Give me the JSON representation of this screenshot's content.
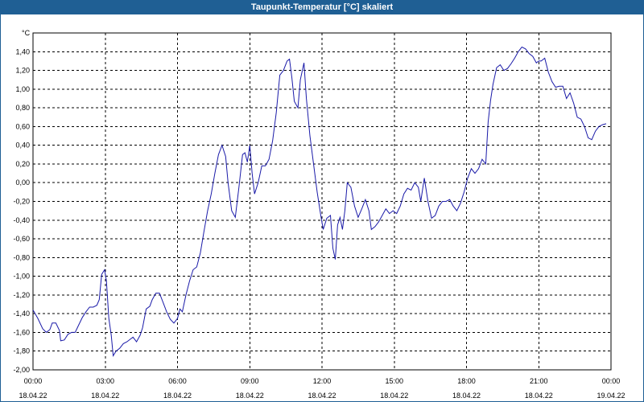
{
  "window": {
    "title": "Taupunkt-Temperatur [°C] skaliert"
  },
  "colors": {
    "titlebar": "#1f5f94",
    "series": "#1a1aa8",
    "grid": "#000000",
    "background": "#ffffff"
  },
  "chart_data": {
    "type": "line",
    "title": "Taupunkt-Temperatur [°C] skaliert",
    "ylabel": "°C",
    "xlabel": "",
    "ylim": [
      -2.0,
      1.6
    ],
    "grid": true,
    "y_ticks": [
      "1,40",
      "1,20",
      "1,00",
      "0,80",
      "0,60",
      "0,40",
      "0,20",
      "0,00",
      "-0,20",
      "-0,40",
      "-0,60",
      "-0,80",
      "-1,00",
      "-1,20",
      "-1,40",
      "-1,60",
      "-1,80",
      "-2,00"
    ],
    "x_ticks": [
      {
        "time": "00:00",
        "date": "18.04.22"
      },
      {
        "time": "03:00",
        "date": "18.04.22"
      },
      {
        "time": "06:00",
        "date": "18.04.22"
      },
      {
        "time": "09:00",
        "date": "18.04.22"
      },
      {
        "time": "12:00",
        "date": "18.04.22"
      },
      {
        "time": "15:00",
        "date": "18.04.22"
      },
      {
        "time": "18:00",
        "date": "18.04.22"
      },
      {
        "time": "21:00",
        "date": "18.04.22"
      },
      {
        "time": "00:00",
        "date": "19.04.22"
      }
    ],
    "xlim_hours": [
      0,
      24
    ],
    "series": [
      {
        "values": [
          [
            0.0,
            -1.36
          ],
          [
            0.2,
            -1.45
          ],
          [
            0.4,
            -1.56
          ],
          [
            0.55,
            -1.6
          ],
          [
            0.7,
            -1.57
          ],
          [
            0.8,
            -1.5
          ],
          [
            0.95,
            -1.5
          ],
          [
            1.1,
            -1.58
          ],
          [
            1.15,
            -1.69
          ],
          [
            1.3,
            -1.68
          ],
          [
            1.45,
            -1.62
          ],
          [
            1.6,
            -1.6
          ],
          [
            1.75,
            -1.6
          ],
          [
            1.9,
            -1.52
          ],
          [
            2.05,
            -1.44
          ],
          [
            2.2,
            -1.38
          ],
          [
            2.35,
            -1.33
          ],
          [
            2.5,
            -1.33
          ],
          [
            2.65,
            -1.31
          ],
          [
            2.75,
            -1.25
          ],
          [
            2.85,
            -0.98
          ],
          [
            2.97,
            -0.93
          ],
          [
            3.05,
            -1.05
          ],
          [
            3.15,
            -1.45
          ],
          [
            3.25,
            -1.63
          ],
          [
            3.33,
            -1.85
          ],
          [
            3.45,
            -1.8
          ],
          [
            3.6,
            -1.77
          ],
          [
            3.75,
            -1.72
          ],
          [
            3.9,
            -1.7
          ],
          [
            4.05,
            -1.67
          ],
          [
            4.15,
            -1.65
          ],
          [
            4.3,
            -1.7
          ],
          [
            4.45,
            -1.63
          ],
          [
            4.55,
            -1.55
          ],
          [
            4.7,
            -1.35
          ],
          [
            4.85,
            -1.32
          ],
          [
            4.95,
            -1.25
          ],
          [
            5.1,
            -1.18
          ],
          [
            5.25,
            -1.18
          ],
          [
            5.4,
            -1.28
          ],
          [
            5.55,
            -1.38
          ],
          [
            5.7,
            -1.46
          ],
          [
            5.85,
            -1.5
          ],
          [
            6.0,
            -1.45
          ],
          [
            6.1,
            -1.35
          ],
          [
            6.2,
            -1.38
          ],
          [
            6.35,
            -1.2
          ],
          [
            6.5,
            -1.05
          ],
          [
            6.65,
            -0.93
          ],
          [
            6.8,
            -0.9
          ],
          [
            6.95,
            -0.75
          ],
          [
            7.1,
            -0.52
          ],
          [
            7.25,
            -0.3
          ],
          [
            7.4,
            -0.12
          ],
          [
            7.55,
            0.1
          ],
          [
            7.7,
            0.3
          ],
          [
            7.85,
            0.4
          ],
          [
            8.0,
            0.28
          ],
          [
            8.1,
            0.0
          ],
          [
            8.25,
            -0.3
          ],
          [
            8.4,
            -0.37
          ],
          [
            8.55,
            -0.05
          ],
          [
            8.7,
            0.3
          ],
          [
            8.8,
            0.32
          ],
          [
            8.9,
            0.22
          ],
          [
            9.0,
            0.4
          ],
          [
            9.1,
            0.1
          ],
          [
            9.2,
            -0.12
          ],
          [
            9.35,
            0.0
          ],
          [
            9.5,
            0.18
          ],
          [
            9.65,
            0.18
          ],
          [
            9.8,
            0.25
          ],
          [
            9.95,
            0.45
          ],
          [
            10.1,
            0.75
          ],
          [
            10.25,
            1.15
          ],
          [
            10.4,
            1.2
          ],
          [
            10.55,
            1.3
          ],
          [
            10.65,
            1.32
          ],
          [
            10.75,
            1.12
          ],
          [
            10.85,
            0.87
          ],
          [
            11.0,
            0.8
          ],
          [
            11.1,
            1.1
          ],
          [
            11.25,
            1.28
          ],
          [
            11.35,
            0.9
          ],
          [
            11.5,
            0.5
          ],
          [
            11.65,
            0.2
          ],
          [
            11.8,
            -0.1
          ],
          [
            11.95,
            -0.35
          ],
          [
            12.05,
            -0.5
          ],
          [
            12.2,
            -0.38
          ],
          [
            12.35,
            -0.35
          ],
          [
            12.45,
            -0.7
          ],
          [
            12.55,
            -0.82
          ],
          [
            12.65,
            -0.45
          ],
          [
            12.75,
            -0.37
          ],
          [
            12.85,
            -0.5
          ],
          [
            12.95,
            -0.3
          ],
          [
            13.05,
            0.0
          ],
          [
            13.2,
            -0.05
          ],
          [
            13.35,
            -0.25
          ],
          [
            13.5,
            -0.37
          ],
          [
            13.65,
            -0.28
          ],
          [
            13.8,
            -0.18
          ],
          [
            13.95,
            -0.3
          ],
          [
            14.05,
            -0.5
          ],
          [
            14.2,
            -0.47
          ],
          [
            14.35,
            -0.42
          ],
          [
            14.5,
            -0.35
          ],
          [
            14.65,
            -0.28
          ],
          [
            14.8,
            -0.33
          ],
          [
            14.95,
            -0.3
          ],
          [
            15.1,
            -0.33
          ],
          [
            15.25,
            -0.25
          ],
          [
            15.4,
            -0.12
          ],
          [
            15.55,
            -0.06
          ],
          [
            15.7,
            -0.08
          ],
          [
            15.85,
            0.0
          ],
          [
            16.0,
            -0.05
          ],
          [
            16.1,
            -0.2
          ],
          [
            16.25,
            0.05
          ],
          [
            16.4,
            -0.2
          ],
          [
            16.55,
            -0.38
          ],
          [
            16.7,
            -0.35
          ],
          [
            16.85,
            -0.25
          ],
          [
            17.0,
            -0.2
          ],
          [
            17.15,
            -0.2
          ],
          [
            17.3,
            -0.18
          ],
          [
            17.45,
            -0.25
          ],
          [
            17.6,
            -0.3
          ],
          [
            17.75,
            -0.22
          ],
          [
            17.9,
            -0.1
          ],
          [
            18.05,
            0.05
          ],
          [
            18.2,
            0.15
          ],
          [
            18.35,
            0.1
          ],
          [
            18.5,
            0.15
          ],
          [
            18.65,
            0.25
          ],
          [
            18.8,
            0.2
          ],
          [
            18.9,
            0.65
          ],
          [
            19.0,
            0.88
          ],
          [
            19.1,
            1.05
          ],
          [
            19.25,
            1.23
          ],
          [
            19.4,
            1.26
          ],
          [
            19.55,
            1.2
          ],
          [
            19.7,
            1.22
          ],
          [
            19.85,
            1.27
          ],
          [
            20.0,
            1.33
          ],
          [
            20.15,
            1.4
          ],
          [
            20.3,
            1.45
          ],
          [
            20.45,
            1.43
          ],
          [
            20.6,
            1.38
          ],
          [
            20.75,
            1.35
          ],
          [
            20.9,
            1.28
          ],
          [
            21.0,
            1.3
          ],
          [
            21.1,
            1.3
          ],
          [
            21.25,
            1.33
          ],
          [
            21.4,
            1.18
          ],
          [
            21.55,
            1.08
          ],
          [
            21.7,
            1.02
          ],
          [
            21.85,
            1.03
          ],
          [
            22.0,
            1.03
          ],
          [
            22.15,
            0.9
          ],
          [
            22.3,
            0.96
          ],
          [
            22.45,
            0.85
          ],
          [
            22.6,
            0.7
          ],
          [
            22.75,
            0.68
          ],
          [
            22.9,
            0.6
          ],
          [
            23.05,
            0.48
          ],
          [
            23.2,
            0.46
          ],
          [
            23.35,
            0.55
          ],
          [
            23.5,
            0.6
          ],
          [
            23.65,
            0.62
          ],
          [
            23.8,
            0.63
          ]
        ]
      }
    ]
  }
}
